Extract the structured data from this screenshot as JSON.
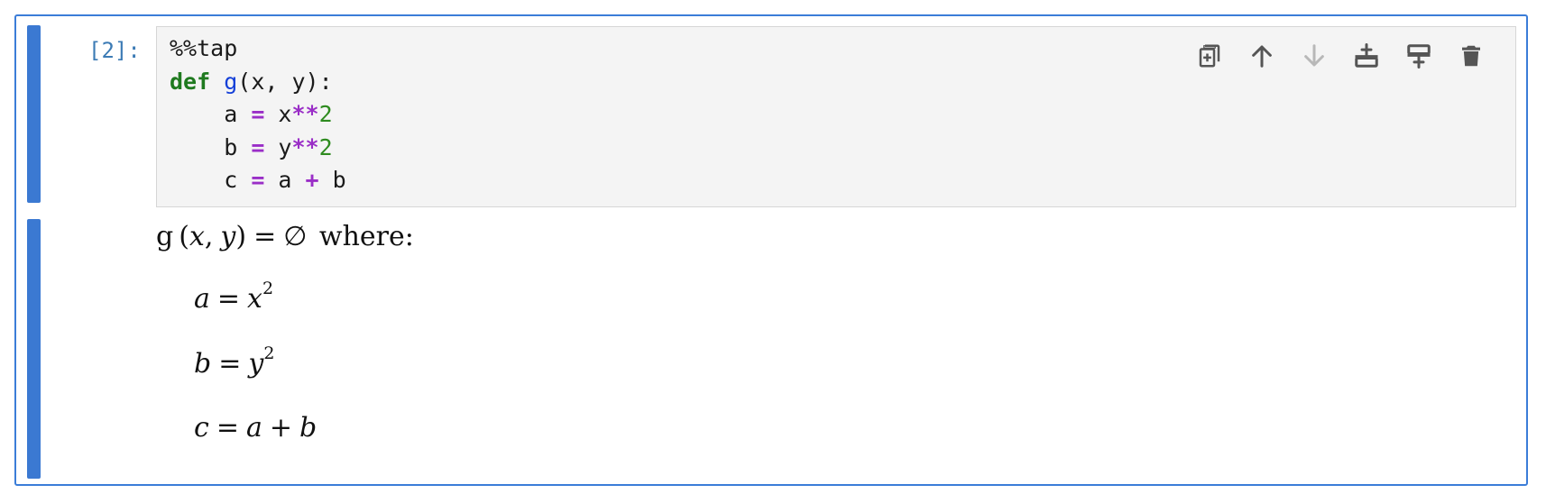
{
  "cell": {
    "prompt": "[2]:",
    "code_lines": [
      [
        {
          "t": "%%tap",
          "c": "plain"
        }
      ],
      [
        {
          "t": "def",
          "c": "kw"
        },
        {
          "t": " ",
          "c": "plain"
        },
        {
          "t": "g",
          "c": "fn"
        },
        {
          "t": "(x, y):",
          "c": "plain"
        }
      ],
      [
        {
          "t": "    a ",
          "c": "plain"
        },
        {
          "t": "=",
          "c": "op"
        },
        {
          "t": " x",
          "c": "plain"
        },
        {
          "t": "**",
          "c": "op"
        },
        {
          "t": "2",
          "c": "num"
        }
      ],
      [
        {
          "t": "    b ",
          "c": "plain"
        },
        {
          "t": "=",
          "c": "op"
        },
        {
          "t": " y",
          "c": "plain"
        },
        {
          "t": "**",
          "c": "op"
        },
        {
          "t": "2",
          "c": "num"
        }
      ],
      [
        {
          "t": "    c ",
          "c": "plain"
        },
        {
          "t": "=",
          "c": "op"
        },
        {
          "t": " a ",
          "c": "plain"
        },
        {
          "t": "+",
          "c": "op"
        },
        {
          "t": " b",
          "c": "plain"
        }
      ]
    ],
    "toolbar": [
      {
        "name": "duplicate-cell-button",
        "icon": "duplicate-icon",
        "enabled": true
      },
      {
        "name": "move-up-button",
        "icon": "arrow-up-icon",
        "enabled": true
      },
      {
        "name": "move-down-button",
        "icon": "arrow-down-icon",
        "enabled": false
      },
      {
        "name": "insert-above-button",
        "icon": "insert-above-icon",
        "enabled": true
      },
      {
        "name": "insert-below-button",
        "icon": "insert-below-icon",
        "enabled": true
      },
      {
        "name": "delete-cell-button",
        "icon": "trash-icon",
        "enabled": true
      }
    ]
  },
  "output": {
    "header": {
      "fname": "g",
      "open": "(",
      "x": "x",
      "comma": ",",
      "y": "y",
      "close": ")",
      "eq": "=",
      "empty": "∅",
      "where": "where:"
    },
    "equations": [
      {
        "lhs": "a",
        "eq": "=",
        "rhs": "x",
        "sup": "2"
      },
      {
        "lhs": "b",
        "eq": "=",
        "rhs": "y",
        "sup": "2"
      },
      {
        "lhs": "c",
        "eq": "=",
        "rhs": "a",
        "op": "+",
        "rhs2": "b"
      }
    ]
  },
  "colors": {
    "accent": "#3b7dd8",
    "collapser": "#3b79d2",
    "prompt": "#3c7bb5",
    "keyword": "#1f7a1f",
    "function": "#1540d8",
    "operator": "#9a2ec7",
    "number": "#2e8b1f",
    "toolbar_icon": "#555555",
    "toolbar_icon_disabled": "#b8b8b8"
  }
}
